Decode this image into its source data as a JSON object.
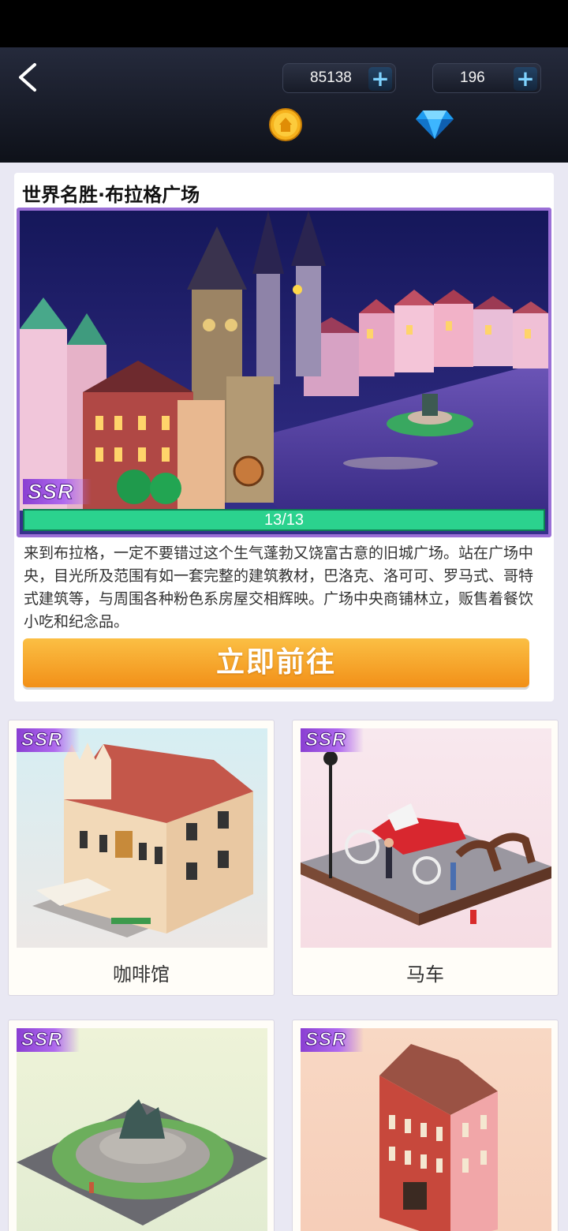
{
  "header": {
    "coins": "85138",
    "gems": "196"
  },
  "feature": {
    "title": "世界名胜·布拉格广场",
    "rarity": "SSR",
    "progress_text": "13/13",
    "progress_fraction": 1.0,
    "description": "来到布拉格，一定不要错过这个生气蓬勃又饶富古意的旧城广场。站在广场中央，目光所及范围有如一套完整的建筑教材，巴洛克、洛可可、罗马式、哥特式建筑等，与周围各种粉色系房屋交相辉映。广场中央商铺林立，贩售着餐饮小吃和纪念品。",
    "button_label": "立即前往"
  },
  "items": [
    {
      "name": "咖啡馆",
      "rarity": "SSR"
    },
    {
      "name": "马车",
      "rarity": "SSR"
    },
    {
      "name": "",
      "rarity": "SSR"
    },
    {
      "name": "",
      "rarity": "SSR"
    }
  ],
  "colors": {
    "accent_purple": "#9a6fd6",
    "progress_green": "#2bd28e",
    "button_orange": "#f29018"
  },
  "icons": [
    "back-arrow-icon",
    "coin-icon",
    "diamond-icon",
    "plus-icon"
  ]
}
